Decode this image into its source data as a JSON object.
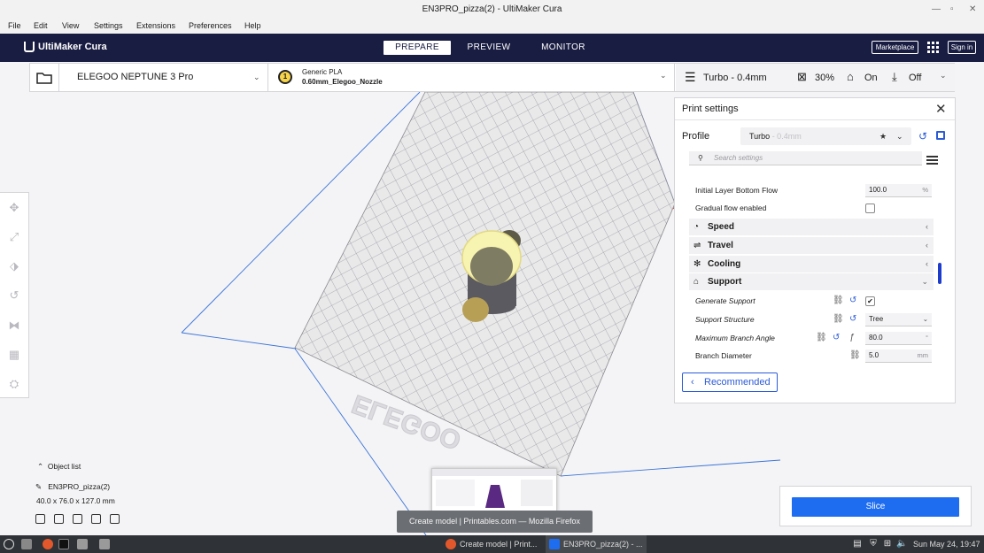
{
  "window": {
    "title": "EN3PRO_pizza(2) - UltiMaker Cura"
  },
  "menu": [
    "File",
    "Edit",
    "View",
    "Settings",
    "Extensions",
    "Preferences",
    "Help"
  ],
  "header": {
    "logo": "UltiMaker Cura",
    "stages": [
      "PREPARE",
      "PREVIEW",
      "MONITOR"
    ],
    "active_stage": "PREPARE",
    "marketplace": "Marketplace",
    "sign_in": "Sign in"
  },
  "toolbar": {
    "printer": "ELEGOO NEPTUNE 3 Pro",
    "material_number": "1",
    "material_name": "Generic PLA",
    "nozzle": "0.60mm_Elegoo_Nozzle",
    "profile": "Turbo - 0.4mm",
    "infill": "30%",
    "support": "On",
    "adhesion": "Off"
  },
  "print_settings": {
    "title": "Print settings",
    "profile_label": "Profile",
    "profile_name": "Turbo",
    "profile_suffix": " - 0.4mm",
    "search_placeholder": "Search settings",
    "rows_top": [
      {
        "label": "Initial Layer Bottom Flow",
        "value": "100.0",
        "unit": "%"
      },
      {
        "label": "Gradual flow enabled",
        "checked": false
      }
    ],
    "categories": [
      {
        "label": "Speed",
        "expanded": false
      },
      {
        "label": "Travel",
        "expanded": false
      },
      {
        "label": "Cooling",
        "expanded": false
      },
      {
        "label": "Support",
        "expanded": true
      }
    ],
    "support_rows": [
      {
        "label": "Generate Support",
        "checked": true
      },
      {
        "label": "Support Structure",
        "value": "Tree"
      },
      {
        "label": "Maximum Branch Angle",
        "value": "80.0",
        "unit": "°"
      },
      {
        "label": "Branch Diameter",
        "value": "5.0",
        "unit": "mm"
      }
    ],
    "recommended": "Recommended"
  },
  "object_list": {
    "header": "Object list",
    "object_name": "EN3PRO_pizza(2)",
    "dimensions": "40.0 x 76.0 x 127.0 mm"
  },
  "bed_logo": "ELEGOO",
  "slice_button": "Slice",
  "tooltip": "Create model | Printables.com — Mozilla Firefox",
  "taskbar": {
    "items": [
      {
        "label": "Create model | Print...",
        "active": false
      },
      {
        "label": "EN3PRO_pizza(2) - ...",
        "active": true
      }
    ],
    "clock": "Sun May 24, 19:47"
  },
  "colors": {
    "header_bg": "#191d42",
    "accent": "#1e6df0",
    "model": "#f7f3b0",
    "taskbar": "#2f3236"
  }
}
